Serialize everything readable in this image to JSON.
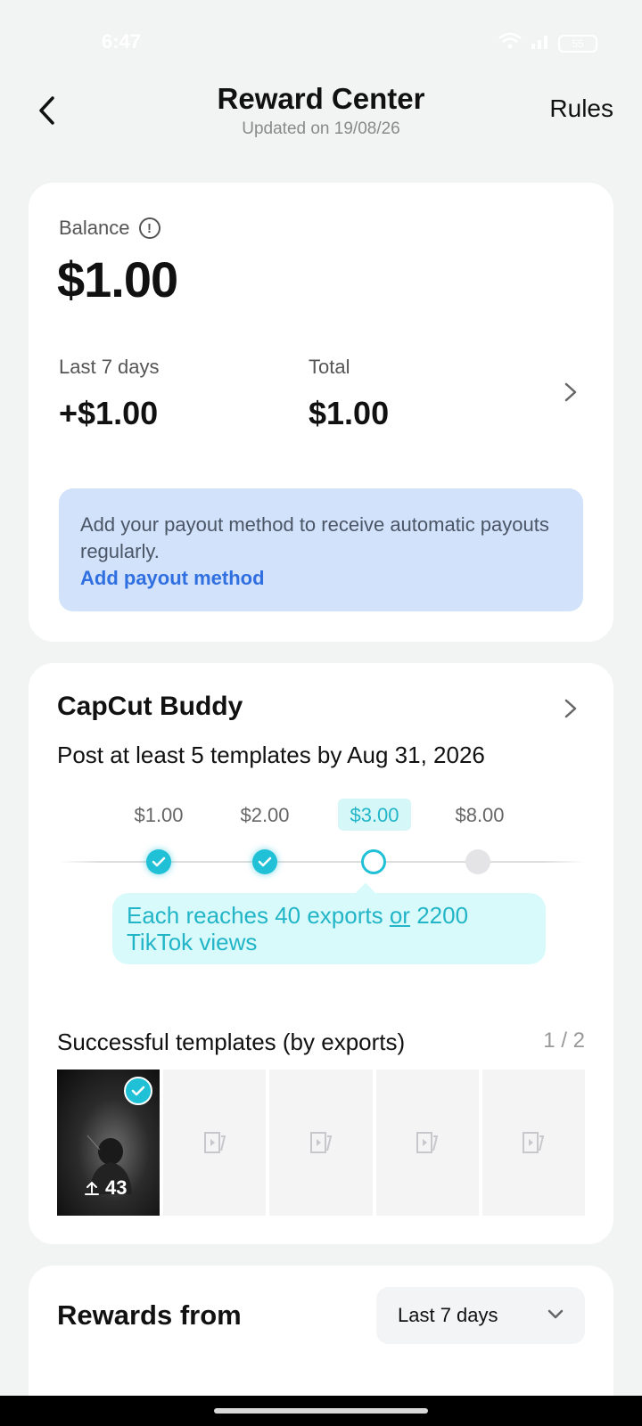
{
  "status_bar": {
    "time": "6:47",
    "battery": "55"
  },
  "header": {
    "title": "Reward Center",
    "subtitle": "Updated on 19/08/26",
    "rules_label": "Rules"
  },
  "balance": {
    "label": "Balance",
    "value": "$1.00",
    "last7_label": "Last 7 days",
    "last7_value": "+$1.00",
    "total_label": "Total",
    "total_value": "$1.00",
    "payout_text": "Add your payout method to receive automatic payouts regularly.",
    "payout_link": "Add payout method"
  },
  "buddy": {
    "title": "CapCut Buddy",
    "description": "Post at least 5 templates by Aug 31, 2026",
    "milestones": [
      {
        "amount": "$1.00",
        "state": "done"
      },
      {
        "amount": "$2.00",
        "state": "done"
      },
      {
        "amount": "$3.00",
        "state": "current"
      },
      {
        "amount": "$8.00",
        "state": "future"
      }
    ],
    "tooltip_part1": "Each reaches 40 exports ",
    "tooltip_or": "or",
    "tooltip_part2": " 2200 TikTok views",
    "templates_title": "Successful templates (by exports)",
    "templates_pager": "1 / 2",
    "template_export_count": "43"
  },
  "rewards": {
    "title": "Rewards from",
    "period": "Last 7 days"
  },
  "colors": {
    "accent": "#20c0d6",
    "link": "#2f6fe0",
    "payout_bg": "#d3e2fb"
  }
}
